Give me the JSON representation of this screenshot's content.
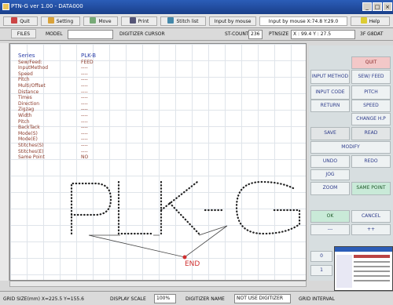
{
  "window": {
    "title": "PTN-G ver 1.00 - DATA000"
  },
  "toolbar": {
    "quit": "Quit",
    "setting": "Setting",
    "move": "Move",
    "print": "Print",
    "stitch_list": "Stitch list",
    "input_by_mouse": "Input by mouse",
    "input_mode_value": "Input by mouse  X:74.8 Y:29.0",
    "help": "Help"
  },
  "status": {
    "files": "FILES",
    "model_label": "MODEL",
    "model_value": "",
    "digitizer_cursor": "DIGITIZER CURSOR",
    "st_count_label": "ST-COUNT",
    "st_count_value": "236",
    "ptnsize_label": "PTNSIZE",
    "ptnsize_value": "X : 99.4  Y : 27.5",
    "gbdat": "3F G8DAT"
  },
  "info": {
    "series_label": "Series",
    "series_value": "PLK-B",
    "rows": [
      {
        "label": "Sew/Feed:",
        "value": "FEED"
      },
      {
        "label": "InputMethod",
        "value": "----"
      },
      {
        "label": "Speed",
        "value": "----"
      },
      {
        "label": "Pitch",
        "value": "----"
      },
      {
        "label": "Multi/Offset",
        "value": "----"
      },
      {
        "label": "    Distance",
        "value": "----"
      },
      {
        "label": "    Times",
        "value": "----"
      },
      {
        "label": "    Direction",
        "value": "----"
      },
      {
        "label": "Zigzag",
        "value": "----"
      },
      {
        "label": "    Width",
        "value": "----"
      },
      {
        "label": "    Pitch",
        "value": "----"
      },
      {
        "label": "BackTack",
        "value": "----"
      },
      {
        "label": "    Mode(S)",
        "value": "----"
      },
      {
        "label": "    Mode(E)",
        "value": "----"
      },
      {
        "label": "    Stitches(S)",
        "value": "----"
      },
      {
        "label": "    Stitches(E)",
        "value": "----"
      },
      {
        "label": "Same Point",
        "value": "NO"
      }
    ]
  },
  "canvas": {
    "pattern_text": "PLK-G",
    "end_label": "END"
  },
  "panel": {
    "quit": "QUIT",
    "input_method": "INPUT METHOD",
    "sew_feed": "SEW/ FEED",
    "input_code": "INPUT CODE",
    "pitch": "PITCH",
    "return": "RETURN",
    "speed": "SPEED",
    "change_hp": "CHANGE H.P",
    "save": "SAVE",
    "read": "READ",
    "modify": "MODIFY",
    "undo": "UNDO",
    "redo": "REDO",
    "jog": "JOG",
    "zoom": "ZOOM",
    "same_point": "SAME POINT",
    "ok": "OK",
    "cancel": "CANCEL",
    "minus": "---",
    "plus": "++",
    "zero": "0",
    "one": "1"
  },
  "bottom": {
    "grid_size": "GRID SIZE(mm)  X=225.5 Y=155.6",
    "display_scale": "DISPLAY SCALE",
    "scale_value": "100%",
    "digitizer_name": "DIGITIZER NAME",
    "digitizer_value": "NOT USE DIGITIZER",
    "grid_interval": "GRID INTERVAL"
  },
  "colors": {
    "titlebar": "#1a3f8a",
    "panel": "#d7dee0",
    "pink": "#f3c8c8",
    "green": "#c9ead8",
    "end": "#d03030"
  }
}
